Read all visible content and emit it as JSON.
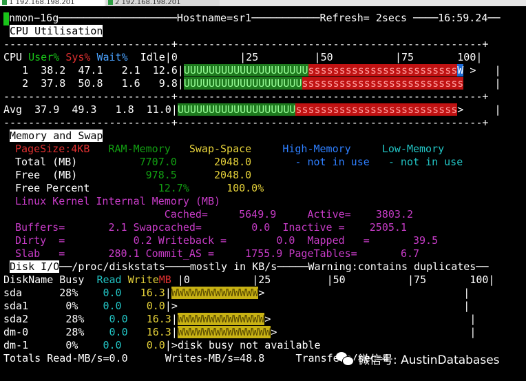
{
  "tabs": [
    {
      "icon": "terminal-icon",
      "label": "1 192.168.198.201"
    },
    {
      "icon": "terminal-icon",
      "label": "2 192.168.198.201"
    }
  ],
  "title_line": "nmon−16g───────────────────Hostname=sr1───────────Refresh= 2secs ────16:59.24──",
  "cpu": {
    "section_title": "CPU Utilisation",
    "header_tail": "───────────────────────────────────────────────────────────────────────",
    "separator": "---------------------------+-------------------------------------------------+",
    "col_cpu": "CPU ",
    "col_user": "User%",
    "col_sys": "Sys%",
    "col_wait": "Wait%",
    "col_idle": "Idle",
    "scale": "|0          |25         |50          |75       100|",
    "rows": [
      {
        "id": " 1",
        "user": "38.2",
        "sys": "47.1",
        "wait": "2.1",
        "idle": "12.6",
        "ubar": "UUUUUUUUUUUUUUUUUUUU",
        "sbar": "ssssssssssssssssssssssss",
        "wbar": "W",
        "tail": " >   |"
      },
      {
        "id": " 2",
        "user": "37.8",
        "sys": "50.8",
        "wait": "1.6",
        "idle": "9.8",
        "ubar": "UUUUUUUUUUUUUUUUUUU",
        "sbar": "ssssssssssssssssssssssssss",
        "wbar": "",
        "tail": "     |"
      }
    ],
    "avg": {
      "id": "Avg",
      "user": "37.9",
      "sys": "49.3",
      "wait": "1.8",
      "idle": "11.0",
      "ubar": "UUUUUUUUUUUUUUUUUUU",
      "sbar": "ssssssssssssssssssssssssss",
      "tail": ">     |"
    }
  },
  "memory": {
    "section_title": "Memory and Swap",
    "pagesize": "PageSize:4KB",
    "ram_label": "RAM-Memory",
    "swap_label": "Swap-Space",
    "high_label": "High-Memory",
    "low_label": "Low-Memory",
    "total_label": "Total (MB)",
    "total_ram": "7707.0",
    "total_swap": "2048.0",
    "not_in_use_high": "- not in use",
    "not_in_use_low": "- not in use",
    "free_label": "Free  (MB)",
    "free_ram": "978.5",
    "free_swap": "2048.0",
    "freepct_label": "Free Percent",
    "freepct_ram": "12.7%",
    "freepct_swap": "100.0%",
    "kernel_title": "Linux Kernel Internal Memory (MB)",
    "cached_label": "Cached=",
    "cached": "5649.9",
    "active_label": "Active=",
    "active": "3803.2",
    "buffers_label": "Buffers=",
    "buffers": "2.1",
    "swapcached_label": "Swapcached=",
    "swapcached": "0.0",
    "inactive_label": "Inactive =",
    "inactive": "2505.1",
    "dirty_label": "Dirty  =",
    "dirty": "0.2",
    "writeback_label": "Writeback =",
    "writeback": "0.0",
    "mapped_label": "Mapped   =",
    "mapped": "39.5",
    "slab_label": "Slab   =",
    "slab": "280.1",
    "commit_label": "Commit_AS =",
    "commit": "1755.9",
    "pagetables_label": "PageTables=",
    "pagetables": "6.7"
  },
  "disk": {
    "section_title": "Disk I/O",
    "header_tail": "──/proc/diskstats────mostly in KB/s─────Warning:contains duplicates──",
    "col_name": "DiskName",
    "col_busy": "Busy",
    "col_read": "Read",
    "col_write": "Write",
    "col_mb": "MB",
    "scale": "|0          |25         |50          |75       100|",
    "rows": [
      {
        "name": "sda",
        "busy": "28%",
        "read": "0.0",
        "write": "16.3",
        "bar": "WWWWWWWWWWWWWW",
        "tail": ">                                |"
      },
      {
        "name": "sda1",
        "busy": "0%",
        "read": "0.0",
        "write": "0.0",
        "bar": "",
        "tail": ">                                              |"
      },
      {
        "name": "sda2",
        "busy": "28%",
        "read": "0.0",
        "write": "16.3",
        "bar": "WWWWWWWWWWWWWW",
        "tail": ">                                |"
      },
      {
        "name": "dm-0",
        "busy": "28%",
        "read": "0.0",
        "write": "16.3",
        "bar": "WWWWWWWWWWWWWWW",
        "tail": ">                               |"
      },
      {
        "name": "dm-1",
        "busy": "0%",
        "read": "0.0",
        "write": "0.0",
        "bar": "",
        "tail": ">disk busy not available"
      }
    ],
    "totals": "Totals Read-MB/s=0.0      Writes-MB/s=48.8     Transfers/sec=4"
  },
  "watermark": {
    "icon": "wechat-icon",
    "text": "微信号: AustinDatabases"
  }
}
